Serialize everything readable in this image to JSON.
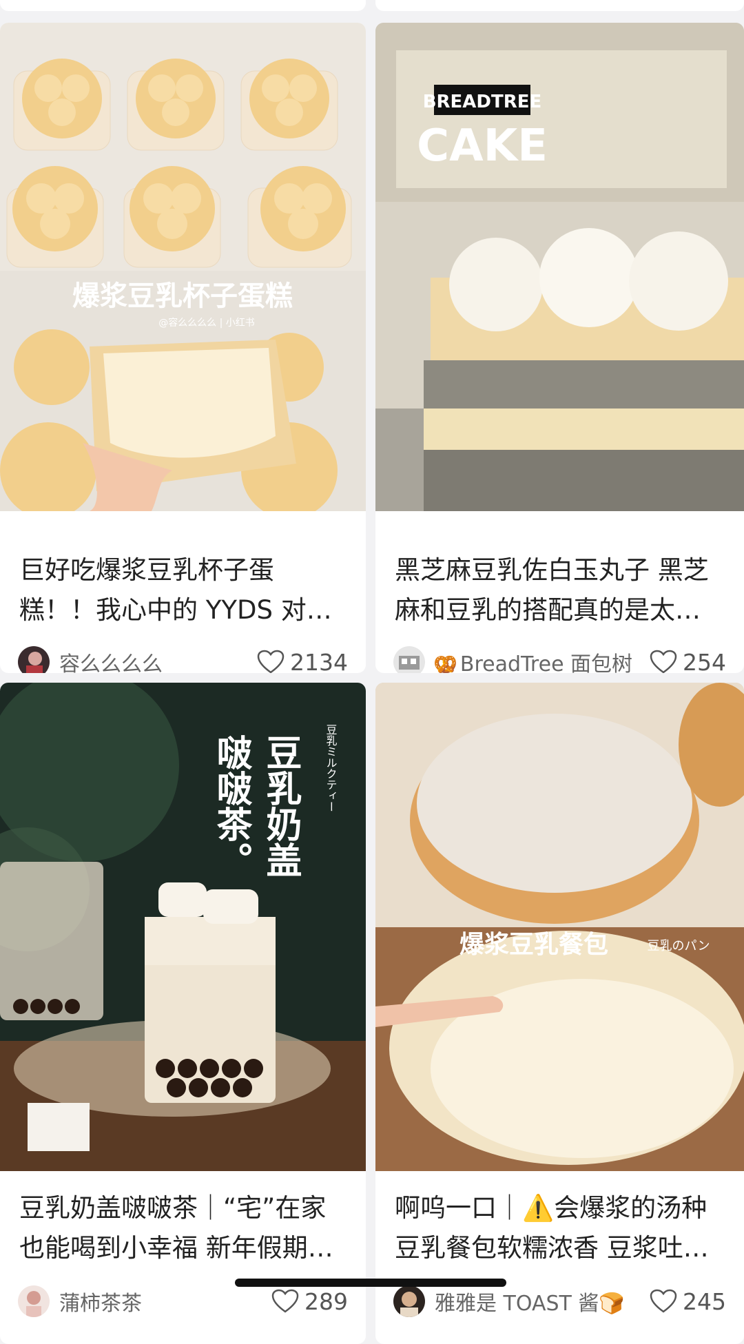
{
  "feed": {
    "cards": [
      {
        "title": "巨好吃爆浆豆乳杯子蛋糕！！我心中的 YYDS 对…",
        "author": "容么么么么",
        "likes": "2134",
        "cover_text": "爆浆豆乳杯子蛋糕",
        "cover_subtext": "@容么么么么 | 小红书"
      },
      {
        "title": "黑芝麻豆乳佐白玉丸子 黑芝麻和豆乳的搭配真的是太…",
        "author": "BreadTree 面包树",
        "author_prefix": "🥨",
        "likes": "254",
        "cover_text_brand": "BREADTREE",
        "cover_text": "CAKE"
      },
      {
        "title": "豆乳奶盖啵啵茶｜“宅”在家也能喝到小幸福 新年假期…",
        "author": "蒲柿茶茶",
        "likes": "289",
        "cover_text_lines": [
          "豆乳奶盖",
          "啵啵茶。"
        ],
        "cover_subtext": "豆乳ミルクティー"
      },
      {
        "title": "啊呜一口｜⚠️会爆浆的汤种豆乳餐包软糯浓香 豆浆吐…",
        "author": "雅雅是 TOAST 酱🍞",
        "likes": "245",
        "cover_text": "爆浆豆乳餐包",
        "cover_subtext": "豆乳のパン"
      }
    ]
  },
  "colors": {
    "background": "#f2f2f4",
    "card": "#ffffff",
    "title": "#222222",
    "meta": "#666666"
  }
}
